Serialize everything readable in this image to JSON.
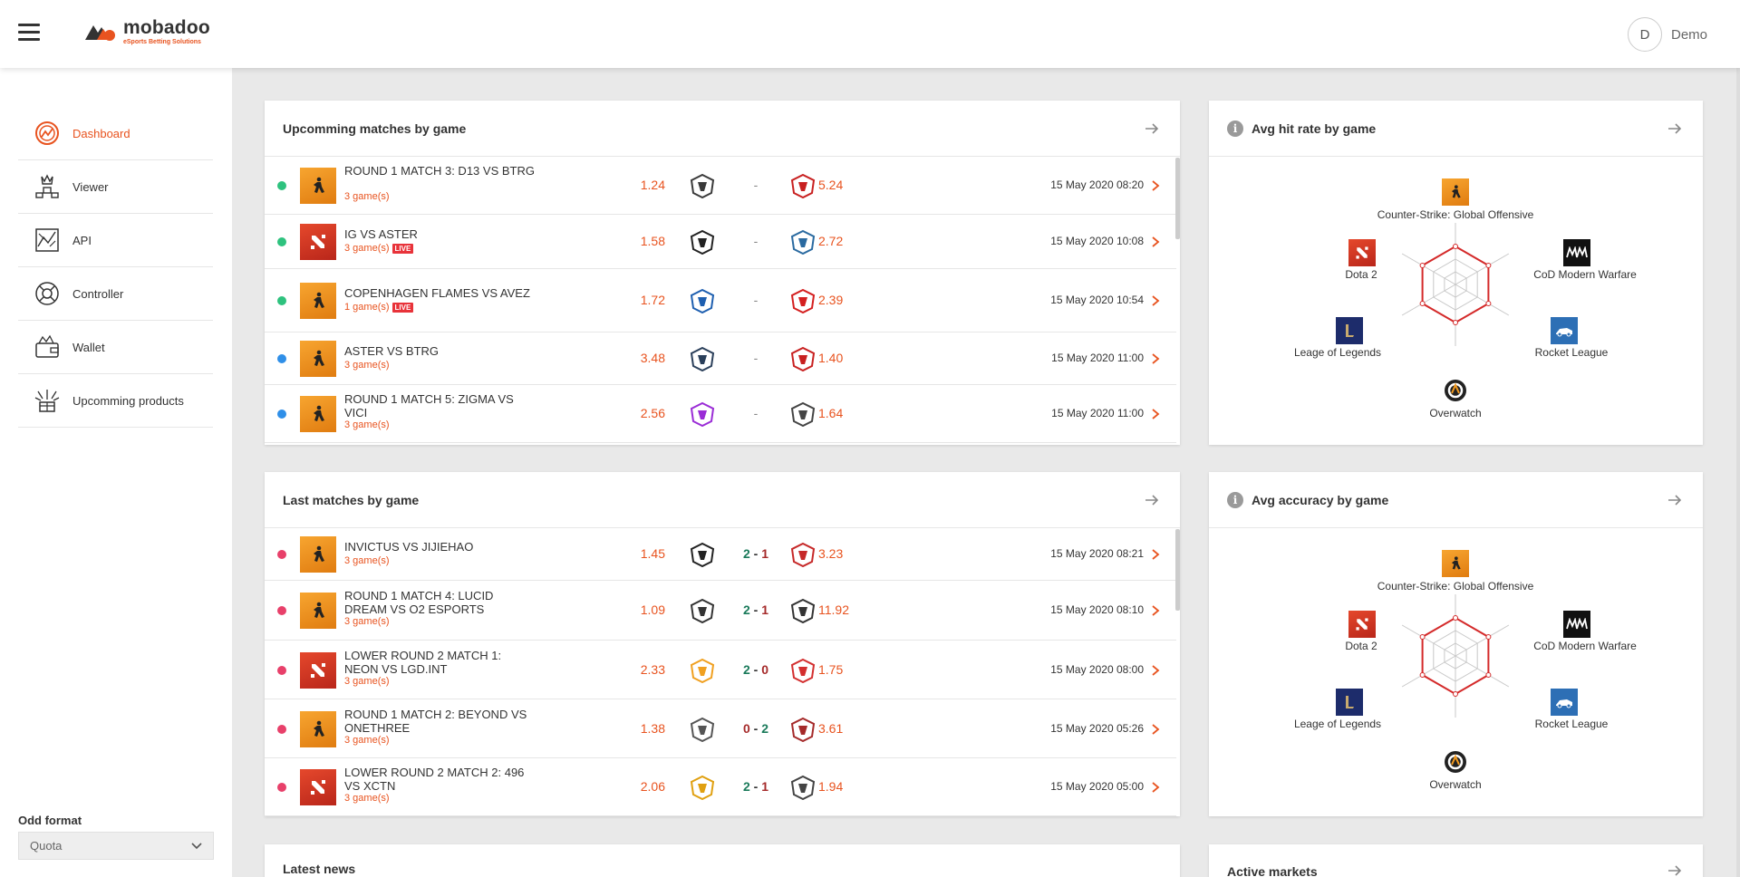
{
  "header": {
    "brand": "mobadoo",
    "tagline": "eSports Betting Solutions",
    "user_initial": "D",
    "user_name": "Demo"
  },
  "sidebar": {
    "items": [
      {
        "label": "Dashboard",
        "icon": "dashboard-icon",
        "active": true
      },
      {
        "label": "Viewer",
        "icon": "viewer-icon",
        "active": false
      },
      {
        "label": "API",
        "icon": "api-icon",
        "active": false
      },
      {
        "label": "Controller",
        "icon": "controller-icon",
        "active": false
      },
      {
        "label": "Wallet",
        "icon": "wallet-icon",
        "active": false
      },
      {
        "label": "Upcomming products",
        "icon": "upcoming-products-icon",
        "active": false
      }
    ],
    "odd_format_label": "Odd format",
    "odd_format_value": "Quota"
  },
  "upcoming": {
    "title": "Upcomming matches by game",
    "rows": [
      {
        "status": "green",
        "game": "csgo",
        "name": "ROUND 1 MATCH 3: D13 VS BTRG",
        "games": "3 game(s)",
        "live": false,
        "odd1": "1.24",
        "mid": "-",
        "odd2": "5.24",
        "date": "15 May 2020 08:20"
      },
      {
        "status": "green",
        "game": "dota",
        "name": "IG VS ASTER",
        "games": "3 game(s)",
        "live": true,
        "odd1": "1.58",
        "mid": "-",
        "odd2": "2.72",
        "date": "15 May 2020 10:08"
      },
      {
        "status": "green",
        "game": "csgo",
        "name": "COPENHAGEN FLAMES VS AVEZ",
        "games": "1 game(s)",
        "live": true,
        "odd1": "1.72",
        "mid": "-",
        "odd2": "2.39",
        "date": "15 May 2020 10:54"
      },
      {
        "status": "blue",
        "game": "csgo",
        "name": "ASTER VS BTRG",
        "games": "3 game(s)",
        "live": false,
        "odd1": "3.48",
        "mid": "-",
        "odd2": "1.40",
        "date": "15 May 2020 11:00"
      },
      {
        "status": "blue",
        "game": "csgo",
        "name": "ROUND 1 MATCH 5: ZIGMA VS VICI",
        "games": "3 game(s)",
        "live": false,
        "odd1": "2.56",
        "mid": "-",
        "odd2": "1.64",
        "date": "15 May 2020 11:00"
      }
    ]
  },
  "last": {
    "title": "Last matches by game",
    "rows": [
      {
        "status": "red",
        "game": "csgo",
        "name": "INVICTUS VS JIJIEHAO",
        "games": "3 game(s)",
        "odd1": "1.45",
        "s1": "2",
        "s2": "1",
        "odd2": "3.23",
        "date": "15 May 2020 08:21"
      },
      {
        "status": "red",
        "game": "csgo",
        "name": "ROUND 1 MATCH 4: LUCID DREAM VS O2 ESPORTS",
        "games": "3 game(s)",
        "odd1": "1.09",
        "s1": "2",
        "s2": "1",
        "odd2": "11.92",
        "date": "15 May 2020 08:10"
      },
      {
        "status": "red",
        "game": "dota",
        "name": "LOWER ROUND 2 MATCH 1: NEON VS LGD.INT",
        "games": "3 game(s)",
        "odd1": "2.33",
        "s1": "2",
        "s2": "0",
        "odd2": "1.75",
        "date": "15 May 2020 08:00"
      },
      {
        "status": "red",
        "game": "csgo",
        "name": "ROUND 1 MATCH 2: BEYOND VS ONETHREE",
        "games": "3 game(s)",
        "odd1": "1.38",
        "s1": "0",
        "s2": "2",
        "odd2": "3.61",
        "date": "15 May 2020 05:26"
      },
      {
        "status": "red",
        "game": "dota",
        "name": "LOWER ROUND 2 MATCH 2: 496 VS XCTN",
        "games": "3 game(s)",
        "odd1": "2.06",
        "s1": "2",
        "s2": "1",
        "odd2": "1.94",
        "date": "15 May 2020 05:00"
      }
    ]
  },
  "hit_rate": {
    "title": "Avg hit rate by game",
    "labels": [
      "Counter-Strike: Global Offensive",
      "CoD Modern Warfare",
      "Rocket League",
      "Overwatch",
      "Leage of Legends",
      "Dota 2"
    ]
  },
  "accuracy": {
    "title": "Avg accuracy by game",
    "labels": [
      "Counter-Strike: Global Offensive",
      "CoD Modern Warfare",
      "Rocket League",
      "Overwatch",
      "Leage of Legends",
      "Dota 2"
    ]
  },
  "news": {
    "title": "Latest news"
  },
  "markets": {
    "title": "Active markets"
  },
  "colors": {
    "accent": "#e8531f",
    "green": "#2ec27e",
    "blue": "#2f8fe8",
    "red": "#e8406a"
  }
}
